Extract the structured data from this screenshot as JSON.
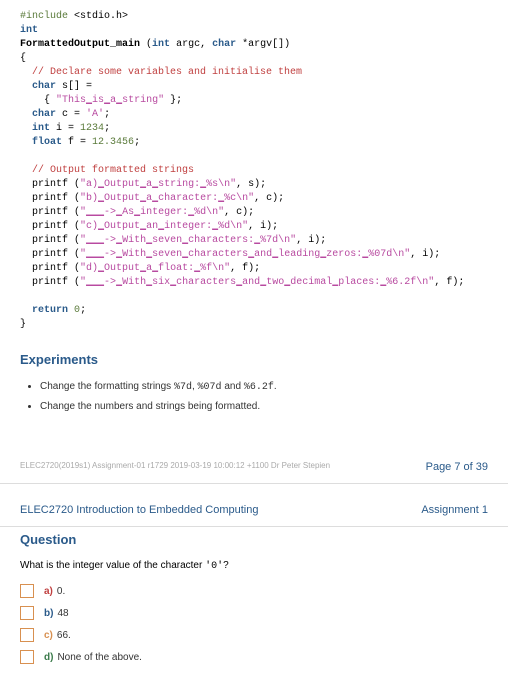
{
  "code": {
    "l1a": "#include",
    "l1b": " <stdio.h>",
    "l2": "int",
    "l3a": "FormattedOutput_main",
    "l3b": " (",
    "l3c": "int",
    "l3d": " argc, ",
    "l3e": "char",
    "l3f": " *argv[])",
    "l4": "{",
    "l5": "  // Declare some variables and initialise them",
    "l6a": "  ",
    "l6b": "char",
    "l6c": " s[] =",
    "l7a": "    { ",
    "l7b": "\"This",
    "l7u1": "_",
    "l7c": "is",
    "l7u2": "_",
    "l7d": "a",
    "l7u3": "_",
    "l7e": "string\"",
    "l7f": " };",
    "l8a": "  ",
    "l8b": "char",
    "l8c": " c = ",
    "l8d": "'A'",
    "l8e": ";",
    "l9a": "  ",
    "l9b": "int",
    "l9c": " i = ",
    "l9d": "1234",
    "l9e": ";",
    "l10a": "  ",
    "l10b": "float",
    "l10c": " f = ",
    "l10d": "12.3456",
    "l10e": ";",
    "l11": "",
    "l12": "  // Output formatted strings",
    "l13a": "  printf (",
    "l13b": "\"a)",
    "l13u1": "_",
    "l13c": "Output",
    "l13u2": "_",
    "l13d": "a",
    "l13u3": "_",
    "l13e": "string:",
    "l13u4": "_",
    "l13f": "%s\\n\"",
    "l13g": ", s);",
    "l14a": "  printf (",
    "l14b": "\"b)",
    "l14u1": "_",
    "l14c": "Output",
    "l14u2": "_",
    "l14d": "a",
    "l14u3": "_",
    "l14e": "character:",
    "l14u4": "_",
    "l14f": "%c\\n\"",
    "l14g": ", c);",
    "l15a": "  printf (",
    "l15b": "\"",
    "l15u1": "___",
    "l15c": "->",
    "l15u2": "_",
    "l15d": "As",
    "l15u3": "_",
    "l15e": "integer:",
    "l15u4": "_",
    "l15f": "%d\\n\"",
    "l15g": ", c);",
    "l16a": "  printf (",
    "l16b": "\"c)",
    "l16u1": "_",
    "l16c": "Output",
    "l16u2": "_",
    "l16d": "an",
    "l16u3": "_",
    "l16e": "integer:",
    "l16u4": "_",
    "l16f": "%d\\n\"",
    "l16g": ", i);",
    "l17a": "  printf (",
    "l17b": "\"",
    "l17u1": "___",
    "l17c": "->",
    "l17u2": "_",
    "l17d": "With",
    "l17u3": "_",
    "l17e": "seven",
    "l17u4": "_",
    "l17f": "characters:",
    "l17u5": "_",
    "l17g": "%7d\\n\"",
    "l17h": ", i);",
    "l18a": "  printf (",
    "l18b": "\"",
    "l18u1": "___",
    "l18c": "->",
    "l18u2": "_",
    "l18d": "With",
    "l18u3": "_",
    "l18e": "seven",
    "l18u4": "_",
    "l18f": "characters",
    "l18u5": "_",
    "l18g": "and",
    "l18u6": "_",
    "l18h": "leading",
    "l18u7": "_",
    "l18i": "zeros:",
    "l18u8": "_",
    "l18j": "%07d\\n\"",
    "l18k": ", i);",
    "l19a": "  printf (",
    "l19b": "\"d)",
    "l19u1": "_",
    "l19c": "Output",
    "l19u2": "_",
    "l19d": "a",
    "l19u3": "_",
    "l19e": "float:",
    "l19u4": "_",
    "l19f": "%f\\n\"",
    "l19g": ", f);",
    "l20a": "  printf (",
    "l20b": "\"",
    "l20u1": "___",
    "l20c": "->",
    "l20u2": "_",
    "l20d": "With",
    "l20u3": "_",
    "l20e": "six",
    "l20u4": "_",
    "l20f": "characters",
    "l20u5": "_",
    "l20g": "and",
    "l20u6": "_",
    "l20h": "two",
    "l20u7": "_",
    "l20i": "decimal",
    "l20u8": "_",
    "l20j": "places:",
    "l20u9": "_",
    "l20k": "%6.2f\\n\"",
    "l20l": ", f);",
    "l21": "",
    "l22a": "  ",
    "l22b": "return",
    "l22c": " ",
    "l22d": "0",
    "l22e": ";",
    "l23": "}"
  },
  "experiments": {
    "title": "Experiments",
    "b1a": "Change the formatting strings ",
    "b1b": "%7d",
    "b1c": ", ",
    "b1d": "%07d",
    "b1e": " and ",
    "b1f": "%6.2f",
    "b1g": ".",
    "b2": "Change the numbers and strings being formatted."
  },
  "footer": {
    "left": "ELEC2720(2019s1) Assignment-01 r1729 2019-03-19 10:00:12 +1100 Dr Peter Stepien",
    "right": "Page 7 of 39"
  },
  "header2": {
    "left": "ELEC2720 Introduction to Embedded Computing",
    "right": "Assignment 1"
  },
  "question": {
    "title": "Question",
    "text_a": "What is the integer value of the character ",
    "text_b": "'0'",
    "text_c": "?",
    "opts": {
      "a_l": "a)",
      "a_t": "0.",
      "b_l": "b)",
      "b_t": "48",
      "c_l": "c)",
      "c_t": "66.",
      "d_l": "d)",
      "d_t": "None of the above."
    }
  }
}
